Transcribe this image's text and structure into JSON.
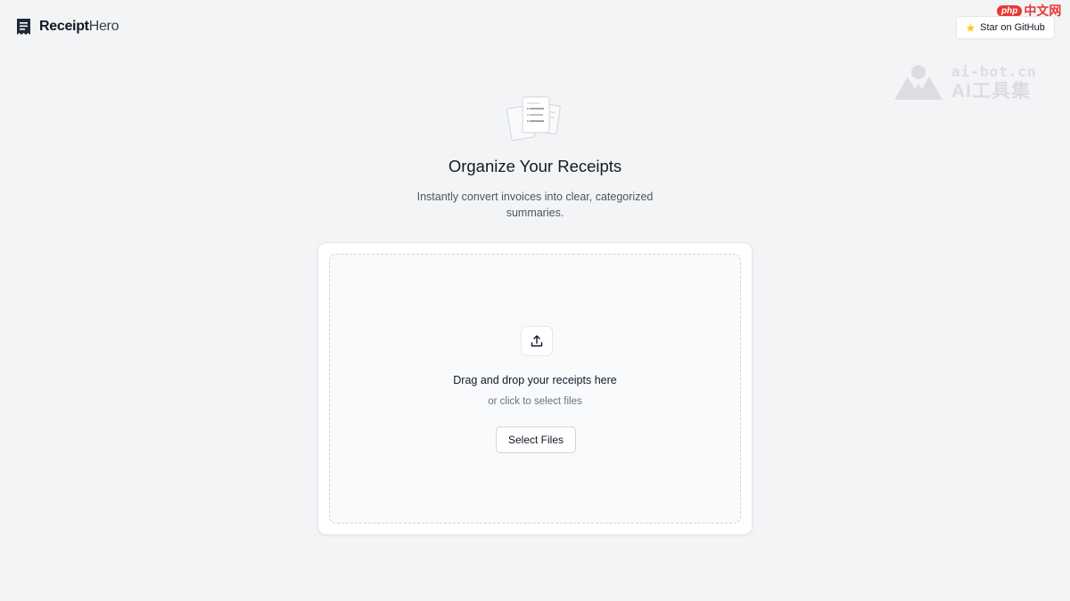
{
  "header": {
    "brand_primary": "Receipt",
    "brand_secondary": "Hero",
    "brand_icon": "receipt-icon",
    "github_label": "Star on GitHub",
    "github_icon": "star-icon"
  },
  "watermarks": {
    "php_badge": "php",
    "php_cn": "中文网",
    "ai_line1": "ai-bot.cn",
    "ai_line2": "AI工具集"
  },
  "hero": {
    "illustration": "receipts-stack-icon",
    "title": "Organize Your Receipts",
    "subtitle": "Instantly convert invoices into clear, categorized summaries."
  },
  "upload": {
    "icon": "upload-icon",
    "title": "Drag and drop your receipts here",
    "subtitle": "or click to select files",
    "button_label": "Select Files"
  },
  "colors": {
    "background": "#f3f4f6",
    "text": "#111827",
    "muted": "#6b7280",
    "star": "#facc15",
    "border": "#e5e7eb"
  }
}
